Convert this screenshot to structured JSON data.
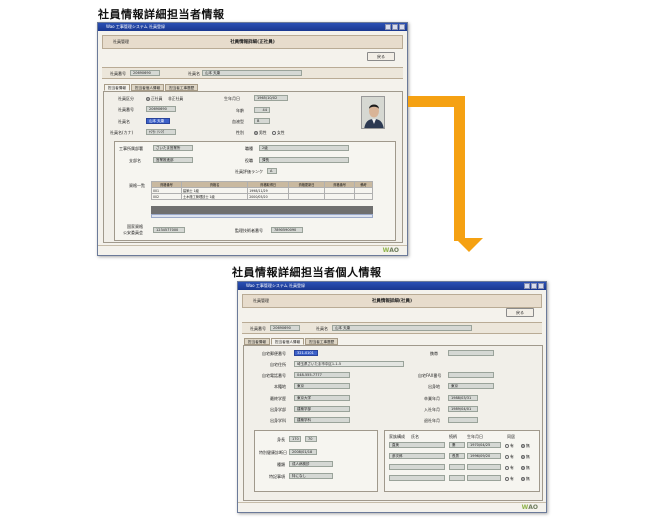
{
  "captions": {
    "top": "社員情報詳細担当者情報",
    "bottom": "社員情報詳細担当者個人情報"
  },
  "common": {
    "window_title": "Wao 工事管理システム 社員登録",
    "menu": "社員管理",
    "back": "戻る",
    "id_label": "社員番号",
    "id_value": "20690690",
    "name_label": "社員名",
    "name_value": "山本 天康",
    "logo_prefix": "W",
    "logo_suffix": "AO"
  },
  "colors": {
    "accent": "#3c61c9",
    "arrow": "#f5a112",
    "band": "#e7dccc",
    "titlebar": "#1a3790"
  },
  "w1": {
    "title": "社員情報詳細(正社員)",
    "tabs": [
      "担当者情報",
      "担当者個人情報",
      "担当者工事履歴"
    ],
    "kubun_label": "社員区分",
    "kubun_on": "正社員",
    "kubun_off": "非正社員",
    "no_label": "社員番号",
    "no_value": "20690690",
    "name_label": "社員名",
    "name_value": "山本 天康",
    "kana_label": "社員名(カナ)",
    "kana_value": "ﾔﾏﾓﾄ ﾃﾝｺｳ",
    "birth_label": "生年月日",
    "birth_value": "1965/10/02",
    "age_label": "年齢",
    "age_value": "44",
    "blood_label": "血液型",
    "blood_value": "B",
    "sex_label": "性別",
    "sex_male": "男性",
    "sex_female": "女性",
    "office_label": "工事所属部署",
    "office_value": "さいたま営業所",
    "dept_label": "支部名",
    "dept_value": "営業推進部",
    "post_label": "職種",
    "post_value": "2級",
    "role_label": "役職",
    "role_value": "課長",
    "rank_label": "社員評価ランク",
    "rank_value": "A",
    "qual_label": "資格一覧",
    "qual_headers": [
      "資格番号",
      "資格名",
      "資格取得日",
      "資格更新日",
      "資格番号",
      "備考"
    ],
    "qual_rows": [
      [
        "001",
        "建築士 1級",
        "1998/11/29",
        "",
        "",
        ""
      ],
      [
        "002",
        "土木施工管理技士 1級",
        "2000/05/20",
        "",
        "",
        ""
      ]
    ],
    "kokken_label": "国家資格",
    "kokken_label2": "公安委員会",
    "kokken_value": "1234577000",
    "kanri_label": "監理技術者番号",
    "kanri_value": "7890590090"
  },
  "w2": {
    "title": "社員情報詳細(社員)",
    "tabs": [
      "担当者情報",
      "担当者個人情報",
      "担当者工事履歴"
    ],
    "zip_label": "自宅郵便番号",
    "zip_value": "321-0101",
    "addr_label": "自宅住所",
    "addr_value": "埼玉県さいたま市中区1-1-5",
    "tel_label": "自宅電話番号",
    "tel_value": "048-555-7777",
    "born_label": "本籍地",
    "born_value": "東京",
    "school_label": "最終学歴",
    "school_value": "東京大学",
    "faculty_label": "出身学部",
    "faculty_value": "建築学部",
    "subject_label": "出身学科",
    "subject_value": "建築学科",
    "mobile_label": "携帯",
    "fax_label": "自宅FAX番号",
    "home_label": "出身地",
    "home_value": "東京",
    "grad_label": "卒業年月",
    "grad_value": "1988/03/31",
    "join_label": "入社年月",
    "join_value": "1989/04/01",
    "quit_label": "退社年月",
    "height_label": "身長",
    "height_value": "170",
    "weight_value": "70",
    "health_label": "特別健康診断日",
    "health_value": "2008/01/18",
    "insurance_label": "種類",
    "insurance_value": "成人病検診",
    "special_label": "特記事項",
    "special_value": "特になし",
    "family_headers": [
      "家族構成",
      "氏名",
      "続柄",
      "生年月日",
      "同居"
    ],
    "family_rows": [
      {
        "name": "直美",
        "rel": "妻",
        "birth": "1970/04/25"
      },
      {
        "name": "彦次郎",
        "rel": "長男",
        "birth": "1996/09/20"
      }
    ],
    "yes": "有",
    "no": "無"
  }
}
